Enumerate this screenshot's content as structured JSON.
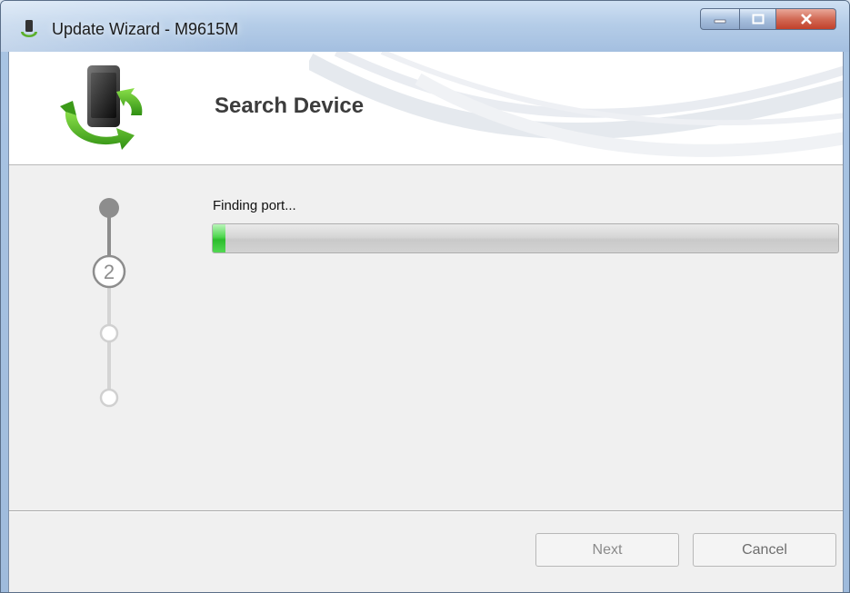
{
  "window": {
    "title": "Update Wizard - M9615M",
    "icons": {
      "app": "phone-sync-icon",
      "minimize": "minimize-icon",
      "maximize": "maximize-icon",
      "close": "close-icon"
    }
  },
  "header": {
    "title": "Search Device",
    "logo_icon": "phone-sync-icon"
  },
  "steps": {
    "current_label": "2",
    "items": [
      {
        "state": "done"
      },
      {
        "state": "current",
        "label": "2"
      },
      {
        "state": "pending"
      },
      {
        "state": "pending"
      }
    ]
  },
  "status": {
    "text": "Finding port...",
    "progress_percent": 2
  },
  "buttons": {
    "next_label": "Next",
    "cancel_label": "Cancel"
  },
  "colors": {
    "progress_green": "#3cc93c",
    "close_red": "#c8452f",
    "logo_green": "#4caf1e"
  }
}
